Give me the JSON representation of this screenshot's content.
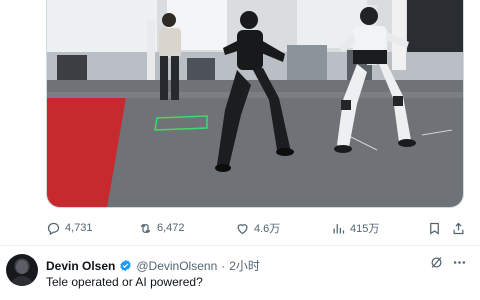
{
  "tweet": {
    "media_alt": "",
    "stats": {
      "replies": "4,731",
      "reposts": "6,472",
      "likes": "4.6万",
      "views": "415万"
    }
  },
  "reply": {
    "author_name": "Devin Olsen",
    "author_handle": "@DevinOlsenn",
    "separator": "·",
    "timestamp": "2小时",
    "text": "Tele operated or AI powered?",
    "verified": true
  },
  "icons": {
    "reply": "reply-icon",
    "repost": "repost-icon",
    "like": "heart-icon",
    "views": "views-chart-icon",
    "bookmark": "bookmark-icon",
    "share": "share-icon",
    "grok": "grok-icon",
    "more": "more-icon",
    "verified": "verified-badge-icon"
  },
  "colors": {
    "text_primary": "#0f1419",
    "text_secondary": "#536471",
    "verified_blue": "#1d9bf0",
    "divider": "#eff3f4"
  }
}
